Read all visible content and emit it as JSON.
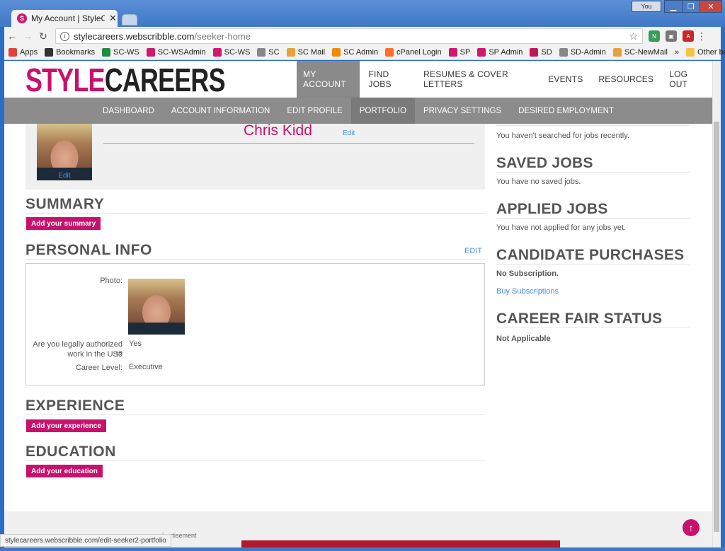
{
  "browser": {
    "tab_title": "My Account | StyleCareer",
    "tab_favicon": "S",
    "user_badge": "You",
    "url_host": "stylecareers.webscribble.com",
    "url_path": "/seeker-home",
    "status_url": "stylecareers.webscribble.com/edit-seeker2-portfolio"
  },
  "bookmarks": [
    {
      "label": "Apps",
      "icon": "apps-grid-icon",
      "color": "#e0433a"
    },
    {
      "label": "Bookmarks",
      "icon": "star-icon",
      "color": "#333333"
    },
    {
      "label": "SC-WS",
      "icon": "sheet-icon",
      "color": "#1e8e3e"
    },
    {
      "label": "SC-WSAdmin",
      "icon": "s-logo-icon",
      "color": "#d0186f"
    },
    {
      "label": "SC-WS",
      "icon": "s-logo-icon",
      "color": "#d0186f"
    },
    {
      "label": "SC",
      "icon": "page-icon",
      "color": "#888888"
    },
    {
      "label": "SC Mail",
      "icon": "mail-icon",
      "color": "#e6a23c"
    },
    {
      "label": "SC Admin",
      "icon": "admin-icon",
      "color": "#f08c00"
    },
    {
      "label": "cPanel Login",
      "icon": "cpanel-icon",
      "color": "#ff6c2c"
    },
    {
      "label": "SP",
      "icon": "sp-logo-icon",
      "color": "#d0186f"
    },
    {
      "label": "SP Admin",
      "icon": "sp-logo-icon",
      "color": "#d0186f"
    },
    {
      "label": "SD",
      "icon": "sd-logo-icon",
      "color": "#c2185b"
    },
    {
      "label": "SD-Admin",
      "icon": "page-icon",
      "color": "#888888"
    },
    {
      "label": "SC-NewMail",
      "icon": "mail-icon",
      "color": "#e6a23c"
    }
  ],
  "bookmarks_more": "»",
  "bookmarks_other": "Other bookmarks",
  "logo": {
    "part1": "STYLE",
    "part2": "CAREERS"
  },
  "topnav": [
    {
      "label": "MY ACCOUNT",
      "active": true
    },
    {
      "label": "FIND JOBS",
      "active": false
    },
    {
      "label": "RESUMES & COVER LETTERS",
      "active": false
    },
    {
      "label": "EVENTS",
      "active": false
    },
    {
      "label": "RESOURCES",
      "active": false
    },
    {
      "label": "LOG OUT",
      "active": false
    }
  ],
  "subnav": [
    {
      "label": "DASHBOARD",
      "active": false
    },
    {
      "label": "ACCOUNT INFORMATION",
      "active": false
    },
    {
      "label": "EDIT PROFILE",
      "active": false
    },
    {
      "label": "PORTFOLIO",
      "active": true
    },
    {
      "label": "PRIVACY SETTINGS",
      "active": false
    },
    {
      "label": "DESIRED EMPLOYMENT",
      "active": false
    }
  ],
  "profile": {
    "name": "Chris Kidd",
    "name_edit": "Edit",
    "photo_edit": "Edit"
  },
  "summary": {
    "heading": "SUMMARY",
    "button": "Add your summary"
  },
  "personal": {
    "heading": "PERSONAL INFO",
    "edit": "EDIT",
    "photo_label": "Photo:",
    "authorized_label_1": "Are you legally authorized to",
    "authorized_label_2": "work in the US?",
    "authorized_value": "Yes",
    "career_label": "Career Level:",
    "career_value": "Executive"
  },
  "experience": {
    "heading": "EXPERIENCE",
    "button": "Add your experience"
  },
  "education": {
    "heading": "EDUCATION",
    "button": "Add your education"
  },
  "sidebar": {
    "searches_text": "You haven't searched for jobs recently.",
    "saved_heading": "SAVED JOBS",
    "saved_text": "You have no saved jobs.",
    "applied_heading": "APPLIED JOBS",
    "applied_text": "You have not applied for any jobs yet.",
    "purchases_heading": "CANDIDATE PURCHASES",
    "purchases_status": "No Subscription.",
    "purchases_link": "Buy Subscriptions",
    "fair_heading": "CAREER FAIR STATUS",
    "fair_status": "Not Applicable"
  },
  "footer": {
    "ad_label": "advertisement"
  },
  "colors": {
    "brand": "#c8116d",
    "link": "#4a90d9",
    "nav_gray": "#8c8c8c"
  }
}
